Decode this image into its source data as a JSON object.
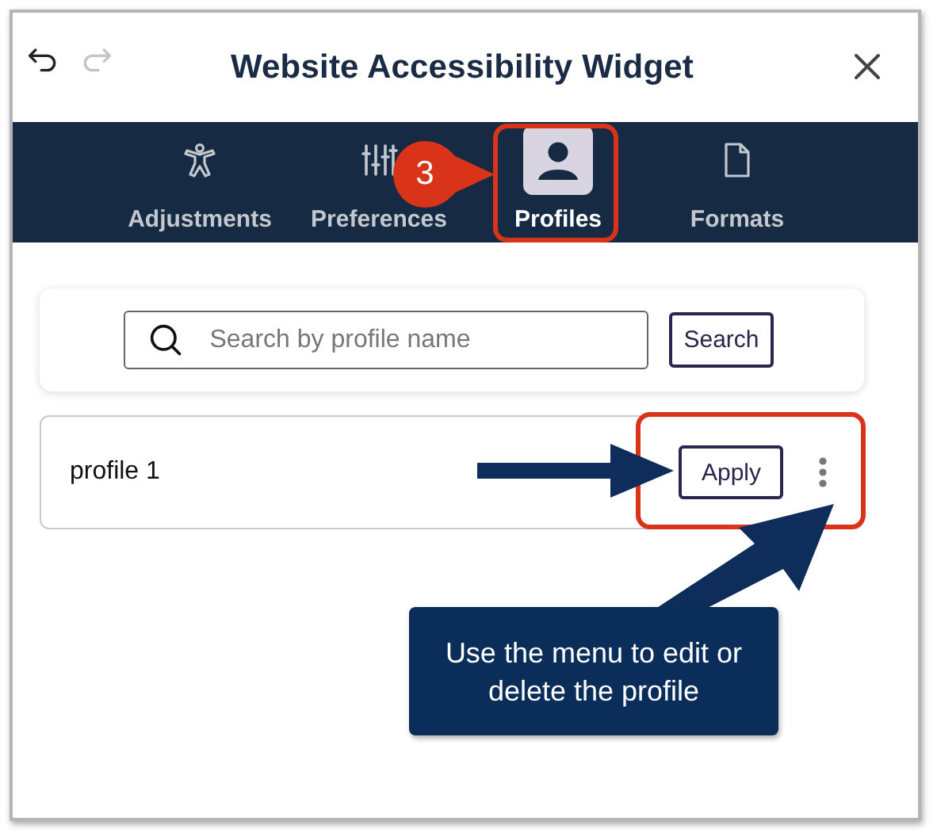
{
  "window": {
    "title": "Website Accessibility Widget"
  },
  "history": [
    {
      "kind": "undo",
      "disabled": false
    },
    {
      "kind": "redo",
      "disabled": true
    }
  ],
  "tabs": [
    {
      "kind": "person",
      "label": "Adjustments",
      "selected": false
    },
    {
      "kind": "sliders",
      "label": "Preferences",
      "selected": false
    },
    {
      "kind": "profile",
      "label": "Profiles",
      "selected": true
    },
    {
      "kind": "document",
      "label": "Formats",
      "selected": false
    }
  ],
  "search": {
    "placeholder": "Search by profile name",
    "button": "Search"
  },
  "profiles": [
    {
      "name": "profile 1",
      "action": "Apply"
    }
  ],
  "annotations": {
    "step": "3",
    "callout": "Use the menu to edit or delete the profile"
  }
}
